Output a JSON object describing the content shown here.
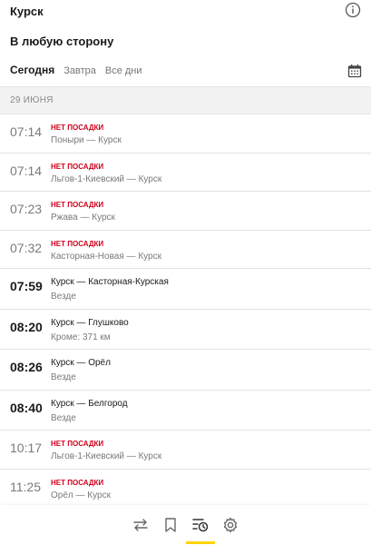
{
  "header": {
    "station": "Курск",
    "info_icon": "info-icon",
    "direction": "В любую сторону",
    "calendar_icon": "calendar-icon"
  },
  "tabs": [
    {
      "label": "Сегодня",
      "active": true
    },
    {
      "label": "Завтра",
      "active": false
    },
    {
      "label": "Все дни",
      "active": false
    }
  ],
  "date": "29 ИЮНЯ",
  "trains": [
    {
      "time": "07:14",
      "notice": "НЕТ ПОСАДКИ",
      "route": "Поныри — Курск",
      "stops": ""
    },
    {
      "time": "07:14",
      "notice": "НЕТ ПОСАДКИ",
      "route": "Льгов-1-Киевский — Курск",
      "stops": ""
    },
    {
      "time": "07:23",
      "notice": "НЕТ ПОСАДКИ",
      "route": "Ржава — Курск",
      "stops": ""
    },
    {
      "time": "07:32",
      "notice": "НЕТ ПОСАДКИ",
      "route": "Касторная-Новая — Курск",
      "stops": ""
    },
    {
      "time": "07:59",
      "notice": "",
      "route": "Курск — Касторная-Курская",
      "stops": "Везде"
    },
    {
      "time": "08:20",
      "notice": "",
      "route": "Курск — Глушково",
      "stops": "Кроме: 371 км"
    },
    {
      "time": "08:26",
      "notice": "",
      "route": "Курск — Орёл",
      "stops": "Везде"
    },
    {
      "time": "08:40",
      "notice": "",
      "route": "Курск — Белгород",
      "stops": "Везде"
    },
    {
      "time": "10:17",
      "notice": "НЕТ ПОСАДКИ",
      "route": "Льгов-1-Киевский — Курск",
      "stops": ""
    },
    {
      "time": "11:25",
      "notice": "НЕТ ПОСАДКИ",
      "route": "Орёл — Курск",
      "stops": ""
    }
  ],
  "bottom_nav": [
    {
      "icon": "route-swap-icon",
      "active": false
    },
    {
      "icon": "bookmark-icon",
      "active": false
    },
    {
      "icon": "schedule-icon",
      "active": true
    },
    {
      "icon": "gear-icon",
      "active": false
    }
  ],
  "colors": {
    "accent": "#ffd400",
    "no_boarding": "#d0021b"
  }
}
